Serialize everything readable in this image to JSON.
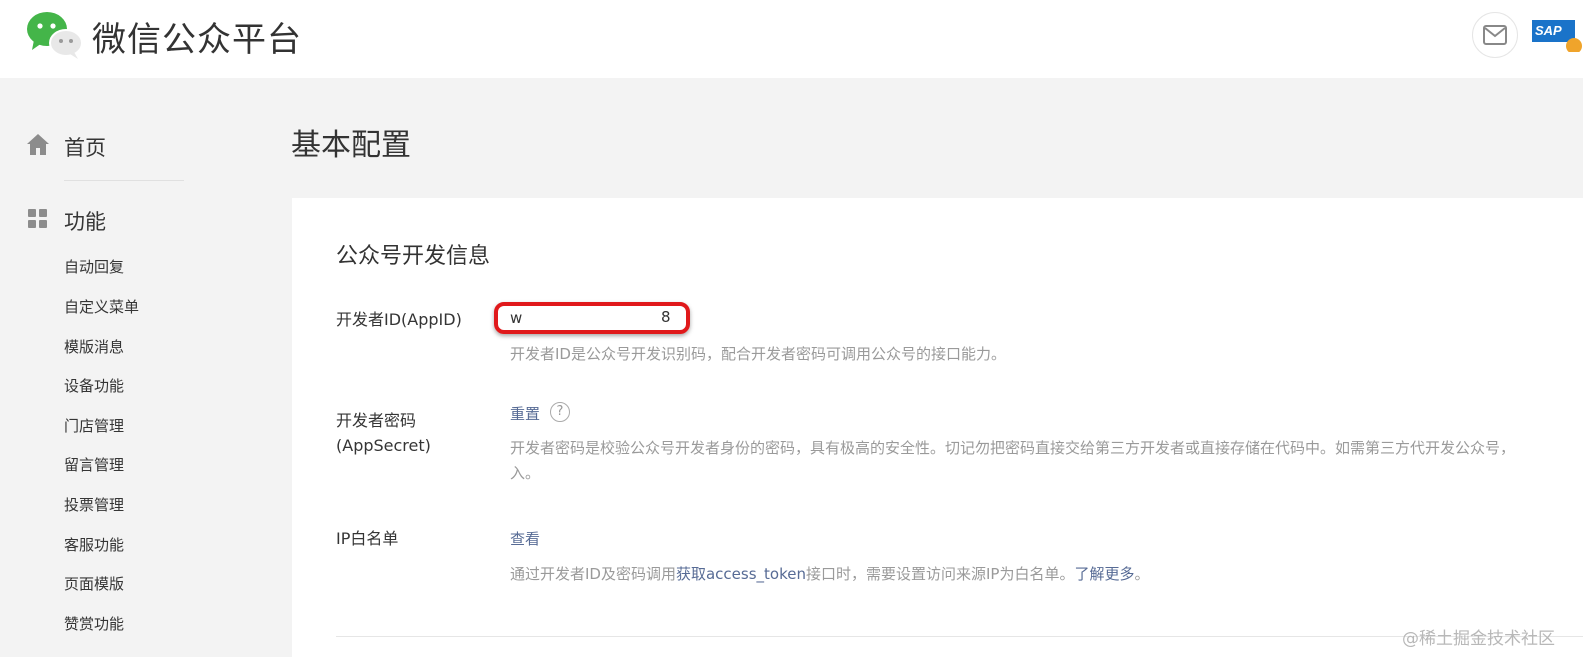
{
  "header": {
    "brand": "微信公众平台",
    "avatar_text": "SAP"
  },
  "sidebar": {
    "home_label": "首页",
    "function_label": "功能",
    "items": [
      {
        "label": "自动回复"
      },
      {
        "label": "自定义菜单"
      },
      {
        "label": "模版消息"
      },
      {
        "label": "设备功能"
      },
      {
        "label": "门店管理"
      },
      {
        "label": "留言管理"
      },
      {
        "label": "投票管理"
      },
      {
        "label": "客服功能"
      },
      {
        "label": "页面模版"
      },
      {
        "label": "赞赏功能"
      }
    ]
  },
  "main": {
    "page_title": "基本配置",
    "section_title": "公众号开发信息",
    "appid": {
      "label": "开发者ID(AppID)",
      "value_start": "w",
      "value_end": "8",
      "desc": "开发者ID是公众号开发识别码，配合开发者密码可调用公众号的接口能力。"
    },
    "secret": {
      "label_line1": "开发者密码",
      "label_line2": "(AppSecret)",
      "reset_link": "重置",
      "help_symbol": "?",
      "desc_line1": "开发者密码是校验公众号开发者身份的密码，具有极高的安全性。切记勿把密码直接交给第三方开发者或直接存储在代码中。如需第三方代开发公众号，",
      "desc_line2": "入。"
    },
    "ip_whitelist": {
      "label": "IP白名单",
      "view_link": "查看",
      "desc_prefix": "通过开发者ID及密码调用",
      "desc_link": "获取access_token",
      "desc_middle": "接口时，需要设置访问来源IP为白名单。",
      "learn_more": "了解更多",
      "desc_suffix": "。"
    }
  },
  "watermark": "@稀土掘金技术社区",
  "colors": {
    "link": "#576b95",
    "highlight_border": "#e0191b",
    "wechat_green": "#44b549"
  }
}
